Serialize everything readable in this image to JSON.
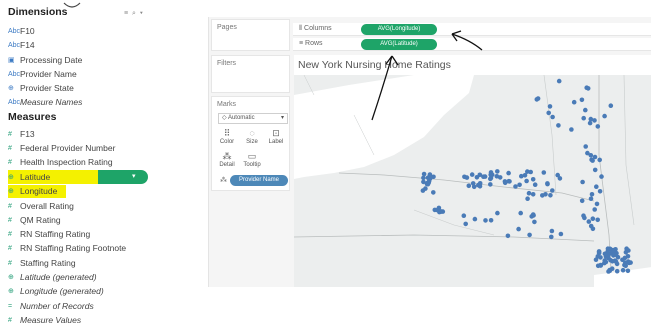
{
  "data_pane": {
    "dimensions_title": "Dimensions",
    "dimensions_tools": "≡ ⌕ ▾",
    "dimensions": [
      {
        "label": "F10",
        "icon": "abc-string-icon"
      },
      {
        "label": "F14",
        "icon": "abc-string-icon"
      },
      {
        "label": "Processing Date",
        "icon": "calendar-icon"
      },
      {
        "label": "Provider Name",
        "icon": "abc-string-icon"
      },
      {
        "label": "Provider State",
        "icon": "globe-icon"
      },
      {
        "label": "Measure Names",
        "icon": "abc-string-icon"
      }
    ],
    "measures_title": "Measures",
    "measures": [
      {
        "label": "F13",
        "icon": "number-icon"
      },
      {
        "label": "Federal Provider Number",
        "icon": "number-icon"
      },
      {
        "label": "Health Inspection Rating",
        "icon": "number-icon"
      },
      {
        "label": "Latitude",
        "icon": "globe-icon"
      },
      {
        "label": "Longitude",
        "icon": "globe-icon"
      },
      {
        "label": "Overall Rating",
        "icon": "number-icon"
      },
      {
        "label": "QM Rating",
        "icon": "number-icon"
      },
      {
        "label": "RN Staffing Rating",
        "icon": "number-icon"
      },
      {
        "label": "RN Staffing Rating Footnote",
        "icon": "number-icon"
      },
      {
        "label": "Staffing Rating",
        "icon": "number-icon"
      },
      {
        "label": "Latitude (generated)",
        "icon": "globe-icon"
      },
      {
        "label": "Longitude (generated)",
        "icon": "globe-icon"
      },
      {
        "label": "Number of Records",
        "icon": "number-icon"
      },
      {
        "label": "Measure Values",
        "icon": "number-icon"
      }
    ],
    "highlight_color": "#f4f100",
    "pill_color": "#1ea468"
  },
  "cards": {
    "pages": "Pages",
    "filters": "Filters",
    "marks": "Marks",
    "mark_type": "◇ Automatic",
    "mark_buttons": [
      "Color",
      "Size",
      "Label",
      "Detail",
      "Tooltip"
    ],
    "detail_pill": "Provider Name"
  },
  "shelves": {
    "columns_label": "Columns",
    "columns_pill": "AVG(Longitude)",
    "rows_label": "Rows",
    "rows_pill": "AVG(Latitude)"
  },
  "viz": {
    "title": "New York Nursing Home Ratings",
    "mark_color": "#4a7bb7"
  }
}
